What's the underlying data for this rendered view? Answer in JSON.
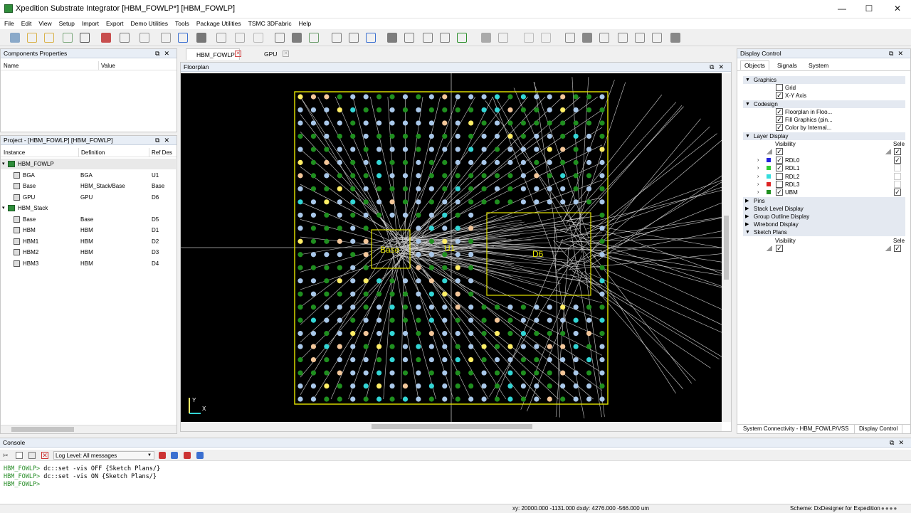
{
  "window": {
    "title": "Xpedition Substrate Integrator [HBM_FOWLP*] [HBM_FOWLP]",
    "minimize": "—",
    "maximize": "☐",
    "close": "✕"
  },
  "menu": [
    "File",
    "Edit",
    "View",
    "Setup",
    "Import",
    "Export",
    "Demo Utilities",
    "Tools",
    "Package Utilities",
    "TSMC 3DFabric",
    "Help"
  ],
  "components_panel": {
    "title": "Components Properties",
    "col_name": "Name",
    "col_value": "Value"
  },
  "project_panel": {
    "title": "Project - [HBM_FOWLP] [HBM_FOWLP]",
    "col_instance": "Instance",
    "col_definition": "Definition",
    "col_refdes": "Ref Des",
    "rows": [
      {
        "instance": "HBM_FOWLP",
        "definition": "",
        "refdes": "",
        "level": 0,
        "group": true
      },
      {
        "instance": "BGA",
        "definition": "BGA",
        "refdes": "U1",
        "level": 1
      },
      {
        "instance": "Base",
        "definition": "HBM_Stack/Base",
        "refdes": "Base",
        "level": 1
      },
      {
        "instance": "GPU",
        "definition": "GPU",
        "refdes": "D6",
        "level": 1
      },
      {
        "instance": "HBM_Stack",
        "definition": "",
        "refdes": "",
        "level": 0,
        "group": true
      },
      {
        "instance": "Base",
        "definition": "Base",
        "refdes": "D5",
        "level": 1
      },
      {
        "instance": "HBM",
        "definition": "HBM",
        "refdes": "D1",
        "level": 1
      },
      {
        "instance": "HBM1",
        "definition": "HBM",
        "refdes": "D2",
        "level": 1
      },
      {
        "instance": "HBM2",
        "definition": "HBM",
        "refdes": "D3",
        "level": 1
      },
      {
        "instance": "HBM3",
        "definition": "HBM",
        "refdes": "D4",
        "level": 1
      }
    ]
  },
  "doc_tabs": [
    {
      "label": "HBM_FOWLP",
      "active": true
    },
    {
      "label": "GPU",
      "active": false
    }
  ],
  "floorplan": {
    "title": "Floorplan",
    "labels": {
      "base": "Base",
      "u1": "U1",
      "d6": "D6"
    },
    "axis_x": "X",
    "axis_y": "Y",
    "colors": {
      "background": "#000000",
      "outline": "#e6e600",
      "pad_green": "#1f8f1f",
      "pad_blue": "#a9c8ea",
      "pad_cyan": "#33d6d6",
      "pad_yellow": "#ffee66",
      "pad_peach": "#f4c79a",
      "wire": "#cfcfcf"
    }
  },
  "display_control": {
    "title": "Display Control",
    "tabs": [
      "Objects",
      "Signals",
      "System"
    ],
    "sections": {
      "graphics": "Graphics",
      "grid": "Grid",
      "xy_axis": "X-Y Axis",
      "codesign": "Codesign",
      "floorplan_in": "Floorplan in Floo...",
      "fill_graphics": "Fill Graphics (pin...",
      "color_by": "Color by Internal...",
      "layer_display": "Layer Display",
      "visibility": "Visibility",
      "select": "Sele",
      "pins": "Pins",
      "stack_level": "Stack Level Display",
      "group_outline": "Group Outline Display",
      "wirebond": "Wirebond Display",
      "sketch_plans": "Sketch Plans",
      "visibility2": "Visibility",
      "select2": "Sele"
    },
    "layers": [
      {
        "name": "RDL0",
        "color": "#2222dd",
        "checked": true,
        "sel": true
      },
      {
        "name": "RDL1",
        "color": "#33cc33",
        "checked": true,
        "sel": false
      },
      {
        "name": "RDL2",
        "color": "#33dddd",
        "checked": false,
        "sel": false
      },
      {
        "name": "RDL3",
        "color": "#dd2222",
        "checked": false,
        "sel": false
      },
      {
        "name": "UBM",
        "color": "#1f8f1f",
        "checked": true,
        "sel": true
      }
    ],
    "bottom_tabs": [
      "System Connectivity - HBM_FOWLP/VSS",
      "Display Control"
    ]
  },
  "console": {
    "title": "Console",
    "log_level": "Log Level: All messages",
    "lines": [
      {
        "prompt": "HBM_FOWLP>",
        "cmd": " dc::set -vis OFF {Sketch Plans/}"
      },
      {
        "prompt": "HBM_FOWLP>",
        "cmd": " dc::set -vis ON {Sketch Plans/}"
      },
      {
        "prompt": "HBM_FOWLP>",
        "cmd": ""
      }
    ]
  },
  "status": {
    "coords": "xy: 20000.000   -1131.000  dxdy: 4276.000   -566.000  um",
    "scheme": "Scheme: DxDesigner for Expedition"
  }
}
